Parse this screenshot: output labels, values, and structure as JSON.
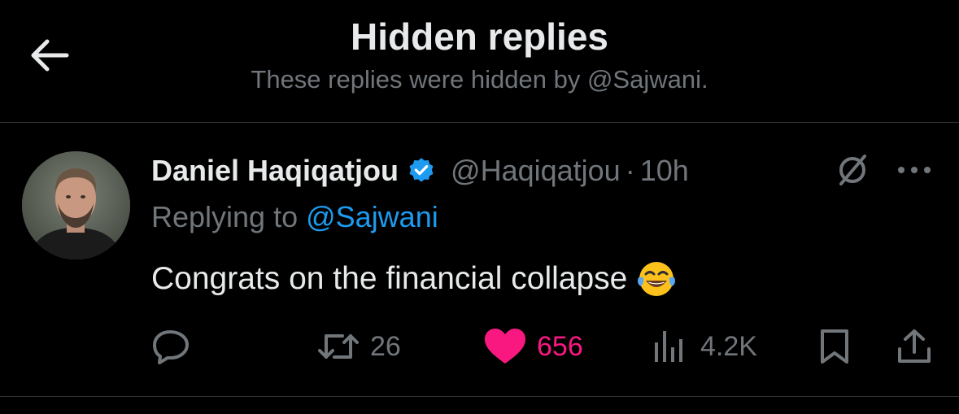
{
  "header": {
    "title": "Hidden replies",
    "subtitle": "These replies were hidden by @Sajwani."
  },
  "tweet": {
    "author_name": "Daniel Haqiqatjou",
    "handle": "@Haqiqatjou",
    "separator": "·",
    "time": "10h",
    "replying_prefix": "Replying to ",
    "replying_to": "@Sajwani",
    "text": "Congrats on the financial collapse",
    "emoji": "face-with-tears-of-joy",
    "actions": {
      "reply_count": "",
      "retweet_count": "26",
      "like_count": "656",
      "views_count": "4.2K"
    }
  },
  "colors": {
    "background": "#000000",
    "text_primary": "#e7e9ea",
    "text_secondary": "#71767b",
    "link": "#1d9bf0",
    "like": "#f91880",
    "divider": "#2f3336",
    "verified": "#1d9bf0"
  },
  "icons": {
    "back": "arrow-left-icon",
    "verified": "verified-badge-icon",
    "hidden": "hidden-reply-icon",
    "more": "more-icon",
    "reply": "reply-icon",
    "retweet": "retweet-icon",
    "like": "heart-icon",
    "views": "views-icon",
    "bookmark": "bookmark-icon",
    "share": "share-icon"
  }
}
